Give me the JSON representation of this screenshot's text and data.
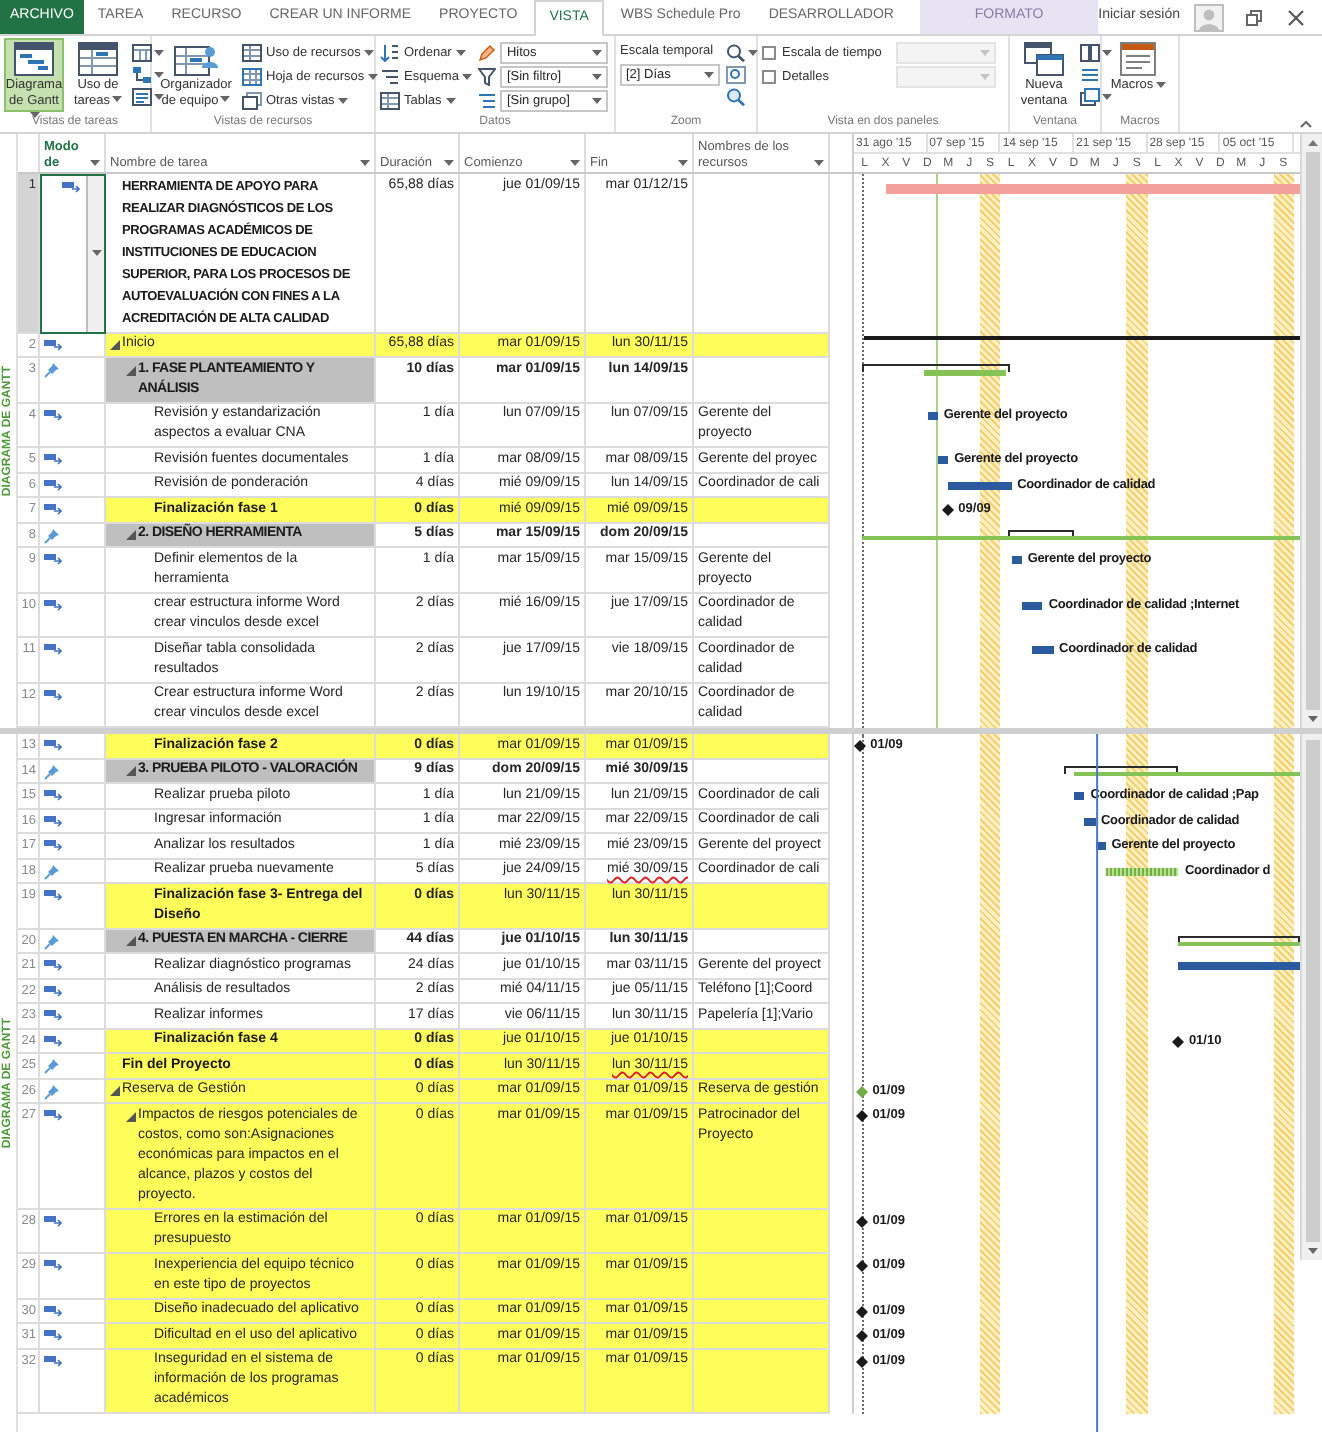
{
  "ribbon": {
    "tabs": [
      {
        "label": "ARCHIVO",
        "kind": "file",
        "selected": false
      },
      {
        "label": "TAREA",
        "kind": "tab",
        "selected": false
      },
      {
        "label": "RECURSO",
        "kind": "tab",
        "selected": false
      },
      {
        "label": "CREAR UN INFORME",
        "kind": "tab",
        "selected": false
      },
      {
        "label": "PROYECTO",
        "kind": "tab",
        "selected": false
      },
      {
        "label": "VISTA",
        "kind": "tab",
        "selected": true
      },
      {
        "label": "WBS Schedule Pro",
        "kind": "tab",
        "selected": false
      },
      {
        "label": "DESARROLLADOR",
        "kind": "tab",
        "selected": false
      },
      {
        "label": "FORMATO",
        "kind": "contextual",
        "selected": false
      }
    ],
    "sign_in": "Iniciar sesión",
    "groups": [
      {
        "label": "Vistas de tareas",
        "items": [
          {
            "kind": "large",
            "label": "Diagrama de Gantt",
            "dropdown": true,
            "selected": true
          },
          {
            "kind": "large",
            "label": "Uso de tareas",
            "dropdown": true,
            "selected": false
          },
          {
            "kind": "icons"
          }
        ]
      },
      {
        "label": "Vistas de recursos",
        "items": [
          {
            "kind": "large",
            "label": "Organizador de equipo",
            "dropdown": true,
            "selected": false
          },
          {
            "kind": "list",
            "entries": [
              {
                "label": "Uso de recursos",
                "dropdown": true
              },
              {
                "label": "Hoja de recursos",
                "dropdown": true
              },
              {
                "label": "Otras vistas",
                "dropdown": true
              }
            ]
          }
        ]
      },
      {
        "label": "Datos",
        "items": [
          {
            "kind": "list",
            "entries": [
              {
                "label": "Ordenar",
                "dropdown": true
              },
              {
                "label": "Esquema",
                "dropdown": true
              },
              {
                "label": "Tablas",
                "dropdown": true
              }
            ]
          },
          {
            "kind": "combos",
            "entries": [
              {
                "value": "Hitos",
                "disabled": false
              },
              {
                "value": "[Sin filtro]",
                "disabled": false
              },
              {
                "value": "[Sin grupo]",
                "disabled": false
              }
            ]
          }
        ]
      },
      {
        "label": "Zoom",
        "items": [
          {
            "kind": "timescale",
            "label": "Escala temporal",
            "value": "[2] Días"
          },
          {
            "kind": "icons"
          }
        ]
      },
      {
        "label": "Vista en dos paneles",
        "items": [
          {
            "kind": "checks",
            "entries": [
              {
                "label": "Escala de tiempo",
                "checked": false
              },
              {
                "label": "Detalles",
                "checked": false
              }
            ]
          },
          {
            "kind": "combos",
            "entries": [
              {
                "disabled": true
              },
              {
                "disabled": true
              }
            ]
          }
        ]
      },
      {
        "label": "Ventana",
        "items": [
          {
            "kind": "large",
            "label": "Nueva ventana",
            "dropdown": false
          },
          {
            "kind": "icons"
          }
        ]
      },
      {
        "label": "Macros",
        "items": [
          {
            "kind": "large",
            "label": "Macros",
            "dropdown": true
          }
        ]
      }
    ]
  },
  "view_bar": {
    "labels": [
      "DIAGRAMA DE GANTT",
      "DIAGRAMA DE GANTT"
    ]
  },
  "gantt": {
    "timescale": {
      "weeks": [
        "31 ago '15",
        "07 sep '15",
        "14 sep '15",
        "21 sep '15",
        "28 sep '15",
        "05 oct '15"
      ],
      "days": [
        "L",
        "X",
        "V",
        "D",
        "M",
        "J",
        "S",
        "L",
        "X",
        "V",
        "D",
        "M",
        "J",
        "S",
        "L",
        "X",
        "V",
        "D",
        "M",
        "J",
        "S"
      ]
    }
  },
  "table": {
    "columns": [
      {
        "label": "Modo de",
        "selected": true
      },
      {
        "label": "Nombre de tarea",
        "selected": false
      },
      {
        "label": "Duración",
        "selected": false
      },
      {
        "label": "Comienzo",
        "selected": false
      },
      {
        "label": "Fin",
        "selected": false
      },
      {
        "label": "Nombres de los recursos",
        "selected": false
      }
    ],
    "rows": [
      {
        "number": "1",
        "manual": false,
        "kind": "project",
        "selected": true,
        "highlighted": false,
        "name": "HERRAMIENTA DE APOYO PARA REALIZAR DIAGNÓSTICOS DE LOS PROGRAMAS ACADÉMICOS DE INSTITUCIONES DE EDUCACION SUPERIOR, PARA LOS PROCESOS DE AUTOEVALUACIÓN CON FINES A LA ACREDITACIÓN DE ALTA CALIDAD",
        "duration": "65,88 días",
        "start": "jue 01/09/15",
        "finish": "mar 01/12/15",
        "finish_flagged": false,
        "gantt": {
          "kind": "project"
        }
      },
      {
        "number": "2",
        "manual": false,
        "kind": "summary",
        "selected": false,
        "highlighted": true,
        "expanded": true,
        "name": "Inicio",
        "duration": "65,88 días",
        "start": "mar 01/09/15",
        "finish": "lun 30/11/15",
        "finish_flagged": false,
        "gantt": {
          "kind": "line"
        },
        "children": [
          {
            "number": "3",
            "manual": true,
            "kind": "phase",
            "selected": false,
            "highlighted": false,
            "expanded": true,
            "name": "1. FASE PLANTEAMIENTO Y ANÁLISIS",
            "duration": "10 días",
            "start": "mar 01/09/15",
            "finish": "lun 14/09/15",
            "finish_flagged": false,
            "gantt": {
              "kind": "summary"
            },
            "children": [
              {
                "number": "4",
                "manual": false,
                "kind": "task",
                "selected": false,
                "highlighted": false,
                "name": "Revisión y estandarización aspectos a evaluar CNA",
                "duration": "1 día",
                "start": "lun 07/09/15",
                "finish": "lun 07/09/15",
                "finish_flagged": false,
                "resources": "Gerente del proyecto",
                "gantt": {
                  "kind": "task",
                  "label": "Gerente del proyecto"
                }
              },
              {
                "number": "5",
                "manual": false,
                "kind": "task",
                "selected": false,
                "highlighted": false,
                "name": "Revisión fuentes documentales",
                "duration": "1 día",
                "start": "mar 08/09/15",
                "finish": "mar 08/09/15",
                "finish_flagged": false,
                "resources": "Gerente del proyec",
                "gantt": {
                  "kind": "task",
                  "label": "Gerente del proyecto"
                }
              },
              {
                "number": "6",
                "manual": false,
                "kind": "task",
                "selected": false,
                "highlighted": false,
                "name": "Revisión de ponderación",
                "duration": "4 días",
                "start": "mié 09/09/15",
                "finish": "lun 14/09/15",
                "finish_flagged": false,
                "resources": "Coordinador de cali",
                "gantt": {
                  "kind": "task",
                  "label": "Coordinador de calidad"
                }
              },
              {
                "number": "7",
                "manual": false,
                "kind": "milestone",
                "selected": false,
                "highlighted": true,
                "name": "Finalización fase 1",
                "duration": "0 días",
                "start": "mié 09/09/15",
                "finish": "mié 09/09/15",
                "finish_flagged": false,
                "gantt": {
                  "kind": "milestone",
                  "label": "09/09",
                  "color": "#1a1a1a"
                }
              }
            ]
          },
          {
            "number": "8",
            "manual": true,
            "kind": "phase",
            "selected": false,
            "highlighted": false,
            "expanded": true,
            "name": "2. DISEÑO HERRAMIENTA",
            "duration": "5 días",
            "start": "mar 15/09/15",
            "finish": "dom 20/09/15",
            "finish_flagged": false,
            "gantt": {
              "kind": "summary"
            },
            "children": [
              {
                "number": "9",
                "manual": false,
                "kind": "task",
                "selected": false,
                "highlighted": false,
                "name": "Definir elementos de la herramienta",
                "duration": "1 día",
                "start": "mar 15/09/15",
                "finish": "mar 15/09/15",
                "finish_flagged": false,
                "resources": "Gerente del proyecto",
                "gantt": {
                  "kind": "task",
                  "label": "Gerente del proyecto"
                }
              },
              {
                "number": "10",
                "manual": false,
                "kind": "task",
                "selected": false,
                "highlighted": false,
                "name": "crear estructura informe Word crear vinculos desde excel",
                "duration": "2 días",
                "start": "mié 16/09/15",
                "finish": "jue 17/09/15",
                "finish_flagged": false,
                "resources": "Coordinador de calidad",
                "gantt": {
                  "kind": "task",
                  "label": "Coordinador de calidad ;Internet"
                }
              },
              {
                "number": "11",
                "manual": false,
                "kind": "task",
                "selected": false,
                "highlighted": false,
                "name": "Diseñar tabla consolidada resultados",
                "duration": "2 días",
                "start": "jue 17/09/15",
                "finish": "vie 18/09/15",
                "finish_flagged": false,
                "resources": "Coordinador de calidad",
                "gantt": {
                  "kind": "task",
                  "label": "Coordinador de calidad"
                }
              },
              {
                "number": "12",
                "manual": false,
                "kind": "task",
                "selected": false,
                "highlighted": false,
                "name": "Crear estructura informe Word crear vinculos desde excel",
                "duration": "2 días",
                "start": "lun 19/10/15",
                "finish": "mar 20/10/15",
                "finish_flagged": false,
                "resources": "Coordinador de calidad"
              },
              {
                "number": "13",
                "manual": false,
                "kind": "milestone",
                "selected": false,
                "highlighted": true,
                "name": "Finalización fase 2",
                "duration": "0 días",
                "start": "mar 01/09/15",
                "finish": "mar 01/09/15",
                "finish_flagged": false,
                "gantt": {
                  "kind": "milestone",
                  "label": "01/09",
                  "color": "#1a1a1a"
                }
              }
            ]
          },
          {
            "number": "14",
            "manual": true,
            "kind": "phase",
            "selected": false,
            "highlighted": false,
            "expanded": true,
            "name": "3. PRUEBA PILOTO - VALORACIÓN",
            "duration": "9 días",
            "start": "dom 20/09/15",
            "finish": "mié 30/09/15",
            "finish_flagged": false,
            "gantt": {
              "kind": "summary"
            },
            "children": [
              {
                "number": "15",
                "manual": false,
                "kind": "task",
                "selected": false,
                "highlighted": false,
                "name": "Realizar prueba piloto",
                "duration": "1 día",
                "start": "lun 21/09/15",
                "finish": "lun 21/09/15",
                "finish_flagged": false,
                "resources": "Coordinador de cali",
                "gantt": {
                  "kind": "task",
                  "label": "Coordinador de calidad ;Pap"
                }
              },
              {
                "number": "16",
                "manual": false,
                "kind": "task",
                "selected": false,
                "highlighted": false,
                "name": "Ingresar información",
                "duration": "1 día",
                "start": "mar 22/09/15",
                "finish": "mar 22/09/15",
                "finish_flagged": false,
                "resources": "Coordinador de cali",
                "gantt": {
                  "kind": "task",
                  "label": "Coordinador de calidad"
                }
              },
              {
                "number": "17",
                "manual": false,
                "kind": "task",
                "selected": false,
                "highlighted": false,
                "name": "Analizar los resultados",
                "duration": "1 día",
                "start": "mié 23/09/15",
                "finish": "mié 23/09/15",
                "finish_flagged": false,
                "resources": "Gerente del proyect",
                "gantt": {
                  "kind": "task",
                  "label": "Gerente del proyecto"
                }
              },
              {
                "number": "18",
                "manual": true,
                "kind": "task",
                "selected": false,
                "highlighted": false,
                "name": "Realizar prueba nuevamente",
                "duration": "5 días",
                "start": "jue 24/09/15",
                "finish": "mié 30/09/15",
                "finish_flagged": true,
                "resources": "Coordinador de cali",
                "gantt": {
                  "kind": "manual",
                  "label": "Coordinador d"
                }
              },
              {
                "number": "19",
                "manual": false,
                "kind": "milestone",
                "selected": false,
                "highlighted": true,
                "name": "Finalización fase 3- Entrega del Diseño",
                "duration": "0 días",
                "start": "lun 30/11/15",
                "finish": "lun 30/11/15",
                "finish_flagged": false
              }
            ]
          },
          {
            "number": "20",
            "manual": true,
            "kind": "phase",
            "selected": false,
            "highlighted": false,
            "expanded": true,
            "name": "4. PUESTA EN MARCHA - CIERRE",
            "duration": "44 días",
            "start": "jue 01/10/15",
            "finish": "lun 30/11/15",
            "finish_flagged": false,
            "gantt": {
              "kind": "summary"
            },
            "children": [
              {
                "number": "21",
                "manual": false,
                "kind": "task",
                "selected": false,
                "highlighted": false,
                "name": "Realizar diagnóstico programas",
                "duration": "24 días",
                "start": "jue 01/10/15",
                "finish": "mar 03/11/15",
                "finish_flagged": false,
                "resources": "Gerente del proyect",
                "gantt": {
                  "kind": "task"
                }
              },
              {
                "number": "22",
                "manual": false,
                "kind": "task",
                "selected": false,
                "highlighted": false,
                "name": "Análisis de resultados",
                "duration": "2 días",
                "start": "mié 04/11/15",
                "finish": "jue 05/11/15",
                "finish_flagged": false,
                "resources": "Teléfono [1];Coord"
              },
              {
                "number": "23",
                "manual": false,
                "kind": "task",
                "selected": false,
                "highlighted": false,
                "name": "Realizar informes",
                "duration": "17 días",
                "start": "vie 06/11/15",
                "finish": "lun 30/11/15",
                "finish_flagged": false,
                "resources": "Papelería [1];Vario"
              },
              {
                "number": "24",
                "manual": false,
                "kind": "milestone",
                "selected": false,
                "highlighted": true,
                "name": "Finalización fase 4",
                "duration": "0 días",
                "start": "jue 01/10/15",
                "finish": "jue 01/10/15",
                "finish_flagged": false,
                "gantt": {
                  "kind": "milestone",
                  "label": "01/10",
                  "color": "#1a1a1a"
                }
              }
            ]
          }
        ]
      },
      {
        "number": "25",
        "manual": true,
        "kind": "milestone",
        "selected": false,
        "highlighted": true,
        "name": "Fin del Proyecto",
        "duration": "0 días",
        "start": "lun 30/11/15",
        "finish": "lun 30/11/15",
        "finish_flagged": true
      },
      {
        "number": "26",
        "manual": true,
        "kind": "summary",
        "selected": false,
        "highlighted": true,
        "expanded": true,
        "name": "Reserva de Gestión",
        "duration": "0 días",
        "start": "mar 01/09/15",
        "finish": "mar 01/09/15",
        "finish_flagged": false,
        "resources": "Reserva de gestión",
        "gantt": {
          "kind": "milestone",
          "label": "01/09",
          "color": "#70ad47"
        },
        "children": [
          {
            "number": "27",
            "manual": false,
            "kind": "summary",
            "selected": false,
            "highlighted": true,
            "expanded": true,
            "name": "Impactos de riesgos potenciales de costos, como son:Asignaciones económicas para impactos en el alcance, plazos y costos del proyecto.",
            "duration": "0 días",
            "start": "mar 01/09/15",
            "finish": "mar 01/09/15",
            "finish_flagged": false,
            "resources": "Patrocinador del Proyecto",
            "gantt": {
              "kind": "milestone",
              "label": "01/09",
              "color": "#1a1a1a"
            },
            "children": [
              {
                "number": "28",
                "manual": false,
                "kind": "task",
                "selected": false,
                "highlighted": true,
                "name": "Errores en la estimación del presupuesto",
                "duration": "0 días",
                "start": "mar 01/09/15",
                "finish": "mar 01/09/15",
                "finish_flagged": false,
                "gantt": {
                  "kind": "milestone",
                  "label": "01/09",
                  "color": "#1a1a1a"
                }
              },
              {
                "number": "29",
                "manual": false,
                "kind": "task",
                "selected": false,
                "highlighted": true,
                "name": "Inexperiencia del equipo técnico en este tipo de proyectos",
                "duration": "0 días",
                "start": "mar 01/09/15",
                "finish": "mar 01/09/15",
                "finish_flagged": false,
                "gantt": {
                  "kind": "milestone",
                  "label": "01/09",
                  "color": "#1a1a1a"
                }
              },
              {
                "number": "30",
                "manual": false,
                "kind": "task",
                "selected": false,
                "highlighted": true,
                "name": "Diseño inadecuado del aplicativo",
                "duration": "0 días",
                "start": "mar 01/09/15",
                "finish": "mar 01/09/15",
                "finish_flagged": false,
                "gantt": {
                  "kind": "milestone",
                  "label": "01/09",
                  "color": "#1a1a1a"
                }
              },
              {
                "number": "31",
                "manual": false,
                "kind": "task",
                "selected": false,
                "highlighted": true,
                "name": "Dificultad en el uso del aplicativo",
                "duration": "0 días",
                "start": "mar 01/09/15",
                "finish": "mar 01/09/15",
                "finish_flagged": false,
                "gantt": {
                  "kind": "milestone",
                  "label": "01/09",
                  "color": "#1a1a1a"
                }
              },
              {
                "number": "32",
                "manual": false,
                "kind": "task",
                "selected": false,
                "highlighted": true,
                "name": "Inseguridad en el sistema de información de los programas académicos",
                "duration": "0 días",
                "start": "mar 01/09/15",
                "finish": "mar 01/09/15",
                "finish_flagged": false,
                "gantt": {
                  "kind": "milestone",
                  "label": "01/09",
                  "color": "#1a1a1a"
                }
              }
            ]
          }
        ]
      }
    ]
  }
}
